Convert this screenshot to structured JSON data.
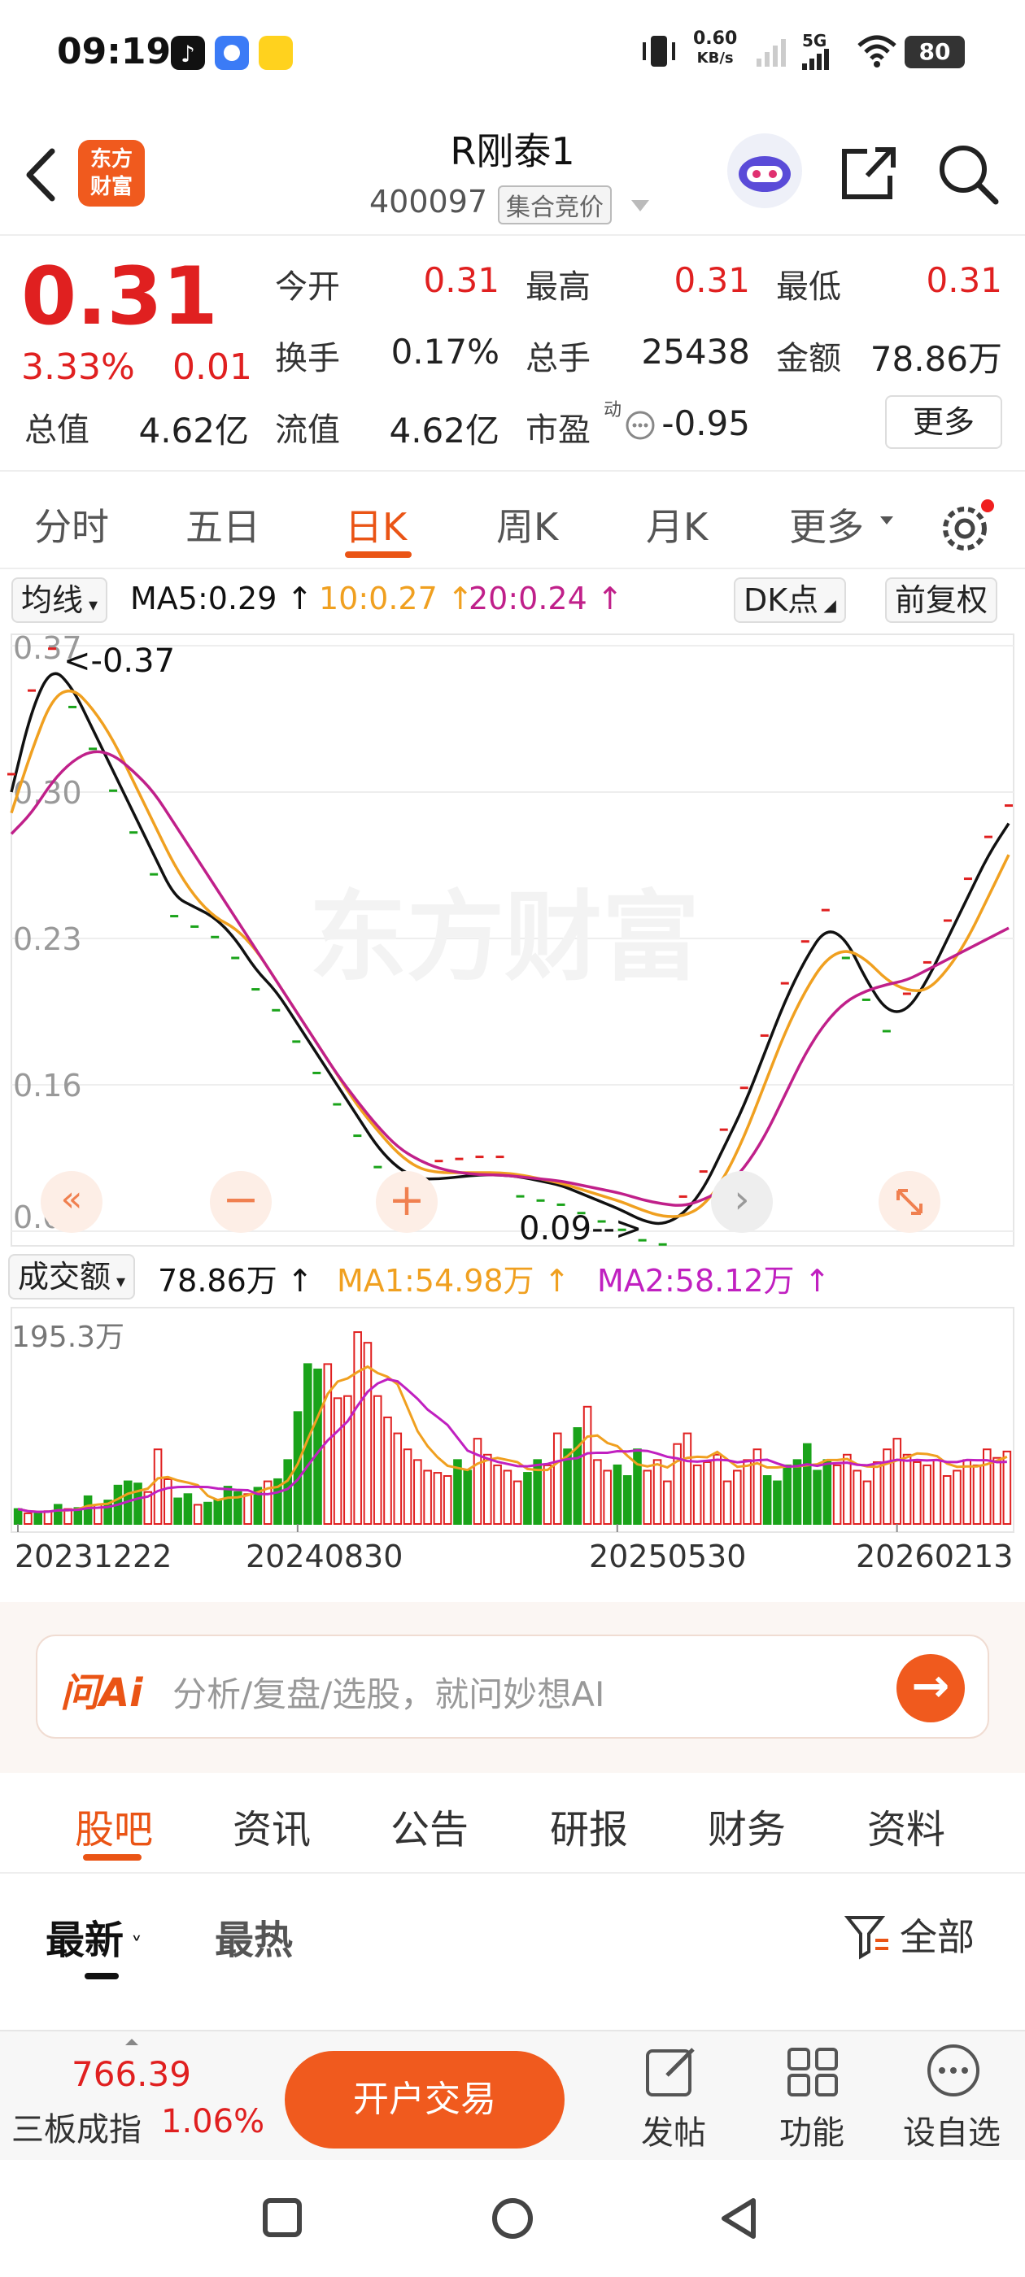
{
  "status_bar": {
    "time": "09:19",
    "net_speed_top": "0.60",
    "net_speed_unit": "KB/s",
    "network": "5G",
    "battery": "80"
  },
  "header": {
    "logo_line1": "东方",
    "logo_line2": "财富",
    "title": "R刚泰1",
    "code": "400097",
    "tag": "集合竞价"
  },
  "quote": {
    "price": "0.31",
    "change_pct": "3.33%",
    "change": "0.01",
    "open_label": "今开",
    "open": "0.31",
    "high_label": "最高",
    "high": "0.31",
    "low_label": "最低",
    "low": "0.31",
    "turnover_label": "换手",
    "turnover": "0.17%",
    "volume_label": "总手",
    "volume": "25438",
    "amount_label": "金额",
    "amount": "78.86万",
    "mktcap_label": "总值",
    "mktcap": "4.62亿",
    "float_label": "流值",
    "float_cap": "4.62亿",
    "pe_label": "市盈",
    "pe_sup": "动",
    "pe": "-0.95",
    "more": "更多"
  },
  "tabs": [
    "分时",
    "五日",
    "日K",
    "周K",
    "月K",
    "更多"
  ],
  "active_tab": "日K",
  "ma_row": {
    "selector": "均线",
    "ma5": "MA5:0.29 ↑",
    "ma10": "10:0.27 ↑",
    "ma20": "20:0.24 ↑",
    "dk": "DK点",
    "adjust": "前复权"
  },
  "colors": {
    "up": "#e02020",
    "down": "#1aa31a",
    "ma5": "#111111",
    "ma10": "#f0a020",
    "ma20": "#c0208a",
    "accent": "#ea5415"
  },
  "kline_labels": {
    "high_marker": "<-0.37",
    "low_marker": "0.09-->"
  },
  "vol_row": {
    "selector": "成交额",
    "value": "78.86万 ↑",
    "ma1": "MA1:54.98万 ↑",
    "ma2": "MA2:58.12万 ↑"
  },
  "chart_data": [
    {
      "type": "line",
      "title": "",
      "y_ticks": [
        "0.37",
        "0.30",
        "0.23",
        "0.16",
        "0.09"
      ],
      "ylim": [
        0.09,
        0.37
      ],
      "series": [
        {
          "name": "MA5",
          "values": [
            0.3,
            0.34,
            0.36,
            0.35,
            0.33,
            0.31,
            0.29,
            0.27,
            0.25,
            0.245,
            0.24,
            0.23,
            0.215,
            0.205,
            0.19,
            0.175,
            0.16,
            0.145,
            0.13,
            0.12,
            0.115,
            0.115,
            0.116,
            0.117,
            0.117,
            0.116,
            0.114,
            0.112,
            0.108,
            0.104,
            0.1,
            0.095,
            0.093,
            0.098,
            0.11,
            0.13,
            0.15,
            0.175,
            0.2,
            0.22,
            0.235,
            0.23,
            0.21,
            0.195,
            0.195,
            0.21,
            0.23,
            0.25,
            0.27,
            0.285
          ]
        },
        {
          "name": "MA10",
          "values": [
            0.29,
            0.32,
            0.345,
            0.35,
            0.34,
            0.325,
            0.305,
            0.285,
            0.265,
            0.25,
            0.24,
            0.235,
            0.225,
            0.21,
            0.195,
            0.18,
            0.165,
            0.15,
            0.138,
            0.127,
            0.12,
            0.118,
            0.118,
            0.118,
            0.118,
            0.117,
            0.115,
            0.113,
            0.11,
            0.107,
            0.104,
            0.1,
            0.097,
            0.097,
            0.102,
            0.115,
            0.135,
            0.16,
            0.185,
            0.205,
            0.22,
            0.225,
            0.22,
            0.21,
            0.205,
            0.205,
            0.215,
            0.23,
            0.25,
            0.27
          ]
        },
        {
          "name": "MA20",
          "values": [
            0.28,
            0.29,
            0.305,
            0.315,
            0.32,
            0.318,
            0.31,
            0.3,
            0.285,
            0.27,
            0.255,
            0.24,
            0.225,
            0.21,
            0.195,
            0.18,
            0.165,
            0.152,
            0.14,
            0.13,
            0.124,
            0.12,
            0.118,
            0.117,
            0.117,
            0.116,
            0.115,
            0.114,
            0.112,
            0.11,
            0.108,
            0.105,
            0.103,
            0.102,
            0.105,
            0.11,
            0.12,
            0.135,
            0.155,
            0.175,
            0.19,
            0.2,
            0.205,
            0.208,
            0.21,
            0.215,
            0.22,
            0.225,
            0.23,
            0.235
          ]
        }
      ]
    },
    {
      "type": "bar",
      "title": "",
      "y_label_top": "195.3万",
      "x_ticks": [
        "20231222",
        "20240830",
        "20250530",
        "20260213"
      ],
      "ylim": [
        0,
        195.3
      ],
      "values": [
        14,
        10,
        10,
        12,
        18,
        14,
        15,
        26,
        18,
        22,
        36,
        40,
        38,
        30,
        70,
        42,
        24,
        28,
        18,
        20,
        22,
        35,
        30,
        28,
        34,
        40,
        42,
        60,
        105,
        150,
        145,
        150,
        118,
        120,
        180,
        170,
        120,
        100,
        85,
        70,
        60,
        50,
        48,
        45,
        60,
        50,
        80,
        65,
        55,
        50,
        40,
        48,
        60,
        55,
        85,
        70,
        90,
        110,
        60,
        50,
        55,
        45,
        70,
        50,
        60,
        40,
        75,
        85,
        55,
        58,
        65,
        40,
        50,
        60,
        70,
        45,
        40,
        55,
        60,
        75,
        50,
        60,
        55,
        65,
        50,
        40,
        58,
        70,
        80,
        65,
        58,
        55,
        60,
        45,
        50,
        60,
        55,
        70,
        62,
        68
      ],
      "ups": [
        0,
        1,
        0,
        1,
        0,
        1,
        0,
        0,
        1,
        0,
        0,
        0,
        0,
        1,
        1,
        1,
        0,
        0,
        1,
        0,
        0,
        0,
        0,
        1,
        0,
        1,
        0,
        0,
        0,
        0,
        0,
        1,
        1,
        1,
        1,
        1,
        1,
        1,
        1,
        1,
        1,
        1,
        1,
        1,
        0,
        0,
        1,
        1,
        1,
        1,
        1,
        0,
        0,
        1,
        1,
        0,
        0,
        1,
        1,
        1,
        0,
        0,
        0,
        1,
        1,
        1,
        1,
        1,
        1,
        1,
        1,
        1,
        1,
        1,
        1,
        0,
        0,
        0,
        0,
        0,
        0,
        0,
        1,
        1,
        1,
        1,
        1,
        1,
        1,
        1,
        1,
        1,
        1,
        1,
        1,
        1,
        1,
        1,
        1,
        1
      ]
    }
  ],
  "ai_box": {
    "logo": "问Ai",
    "placeholder": "分析/复盘/选股，就问妙想AI"
  },
  "bottom_tabs": [
    "股吧",
    "资讯",
    "公告",
    "研报",
    "财务",
    "资料"
  ],
  "sort": {
    "latest": "最新",
    "hot": "最热",
    "filter": "全部"
  },
  "bottom_bar": {
    "index_value": "766.39",
    "index_name": "三板成指",
    "index_pct": "1.06%",
    "trade_button": "开户交易",
    "post": "发帖",
    "features": "功能",
    "watchlist": "设自选"
  }
}
